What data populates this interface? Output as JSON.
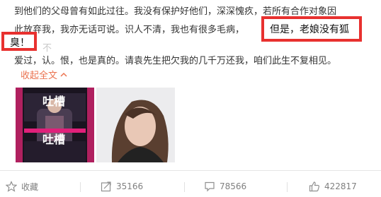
{
  "post": {
    "line1": "到他们的父母曾有如此过往。我没有保护好他们，深深愧疚，若所有合作对象因",
    "line2": "此放弃我，我亦无话可说。识人不清，我也有很多毛病，",
    "line3_ghost": "不",
    "line4": "爱过，认。恨，也是真的。请袁先生把欠我的几千万还我，咱们此生不复相见。",
    "highlight_1": "但是，老娘没有狐",
    "highlight_2": "臭！",
    "collapse_label": "收起全文"
  },
  "images": {
    "image1_caption": "吐槽",
    "image1_caption_bottom": "吐槽"
  },
  "actions": {
    "favorite_label": "收藏",
    "share_count": "35166",
    "comment_count": "78566",
    "like_count": "422817"
  },
  "colors": {
    "highlight_border": "#e8312f",
    "link": "#eb7350",
    "muted": "#808080"
  }
}
